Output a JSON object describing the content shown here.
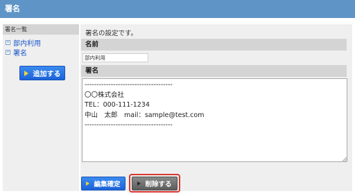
{
  "header": {
    "title": "署名"
  },
  "sidebar": {
    "heading": "署名一覧",
    "items": [
      {
        "label": "部内利用"
      },
      {
        "label": "署名"
      }
    ],
    "add_button": "追加する"
  },
  "main": {
    "description": "署名の設定です。",
    "name_section": {
      "label": "名前",
      "value": "部内利用"
    },
    "signature_section": {
      "label": "署名",
      "value": "-------------------------------------\n〇〇株式会社\nTEL：000-111-1234\n中山　太郎　mail：sample@test.com\n-------------------------------------"
    },
    "confirm_button": "編集確定",
    "delete_button": "削除する"
  },
  "colors": {
    "title_bar": "#5f95c6",
    "primary_button": "#1c62d8",
    "delete_button": "#5c5c5c",
    "highlight": "#d9362f",
    "link": "#1a57c9"
  }
}
